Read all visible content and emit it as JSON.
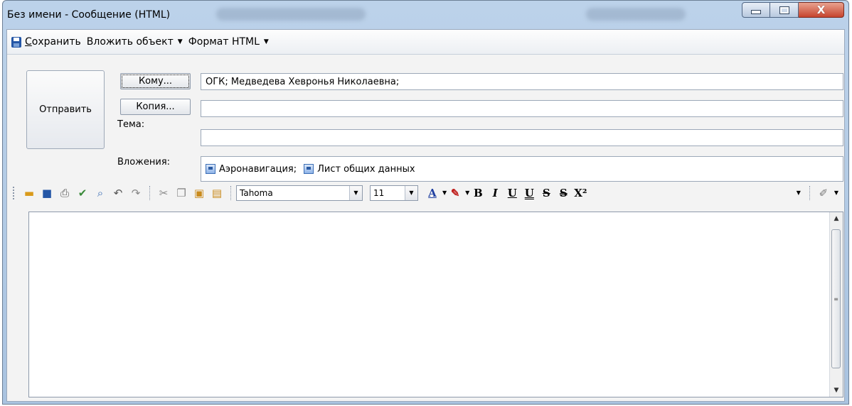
{
  "window": {
    "title": "Без имени - Сообщение (HTML)",
    "caption": {
      "minimize": "—",
      "maximize": "□",
      "close": "X"
    }
  },
  "menubar": {
    "save": {
      "underline_char": "С",
      "rest": "охранить"
    },
    "attach_object": "Вложить объект",
    "format": "Формат HTML"
  },
  "compose": {
    "send_label": "Отправить",
    "to_button": "Кому...",
    "cc_button": "Копия...",
    "subject_label": "Тема:",
    "attachments_label": "Вложения:",
    "to_value": "ОГК; Медведева Хевронья Николаевна;",
    "cc_value": "",
    "subject_value": "",
    "attachments": [
      "Аэронавигация;",
      "Лист общих данных"
    ]
  },
  "format_toolbar": {
    "font": "Tahoma",
    "size": "11",
    "icons": [
      "open-icon",
      "save-icon",
      "print-icon",
      "spellcheck-icon",
      "preview-icon",
      "undo-icon",
      "redo-icon",
      "cut-icon",
      "copy-icon",
      "paste-icon",
      "paste-special-icon"
    ],
    "format_buttons": {
      "bold": "B",
      "italic": "I",
      "underline": "U",
      "double_underline": "U",
      "strike": "S",
      "double_strike": "S",
      "superscript": "X²"
    }
  },
  "colors": {
    "title_bar": "#a9c3e0",
    "client_bg": "#f3f3f3",
    "font_color_accent": "#1f3fa0",
    "highlight_accent": "#c0201e",
    "close_button": "#c6442e"
  }
}
